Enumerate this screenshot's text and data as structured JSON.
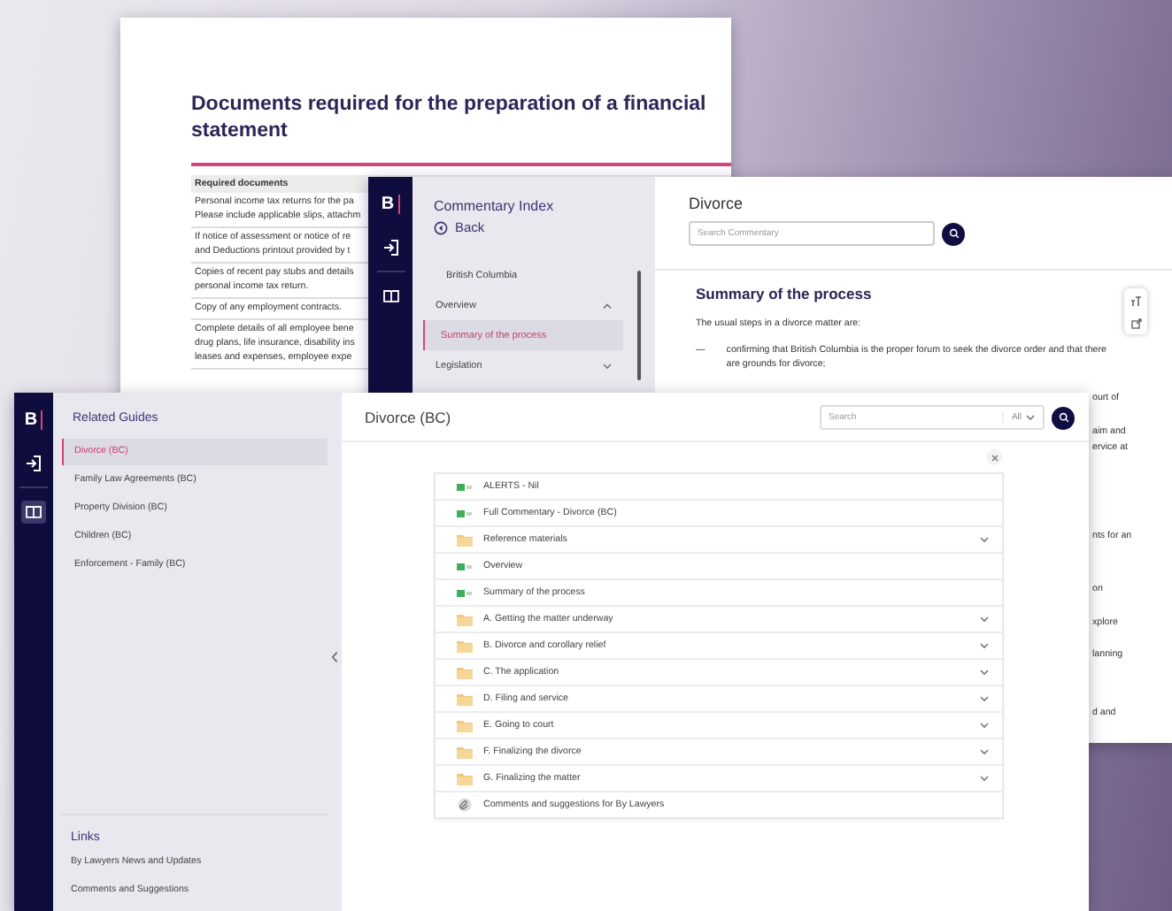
{
  "document_window": {
    "title": "Documents required for the preparation of a financial statement",
    "table_header": "Required documents",
    "rows": [
      [
        "Personal income tax returns for the pa",
        "Please include applicable slips, attachm"
      ],
      [
        "If notice of assessment or notice of re",
        "and Deductions printout provided by t"
      ],
      [
        "Copies of recent pay stubs and details",
        "personal income tax return."
      ],
      [
        "Copy of any employment contracts."
      ],
      [
        "Complete details of all employee bene",
        "drug plans, life insurance, disability ins",
        "leases and expenses, employee expe"
      ]
    ]
  },
  "commentary_window": {
    "logo": "B",
    "nav": [
      {
        "kind": "sign-in",
        "selected": false
      },
      {
        "kind": "book",
        "selected": false
      }
    ],
    "index_title": "Commentary Index",
    "back": "Back",
    "index_items": [
      {
        "label": "British Columbia",
        "kind": "page",
        "selected": false
      },
      {
        "label": "Overview",
        "kind": "section",
        "expanded": true,
        "selected": false
      },
      {
        "label": "Summary of the process",
        "kind": "page",
        "selected": true
      },
      {
        "label": "Legislation",
        "kind": "section",
        "expanded": false,
        "selected": false
      }
    ],
    "title": "Divorce",
    "search": {
      "placeholder": "Search Commentary"
    },
    "heading": "Summary of the process",
    "intro": "The usual steps in a divorce matter are:",
    "steps": [
      {
        "marker": "—",
        "text": "confirming that British Columbia is the proper forum to seek the divorce order and that there are grounds for divorce;"
      }
    ],
    "fragments": [
      "ourt of",
      "aim and",
      "ervice at",
      "nts for an",
      "on",
      "xplore",
      "lanning",
      "d and"
    ]
  },
  "guide_window": {
    "logo": "B",
    "nav": [
      {
        "kind": "sign-in",
        "selected": false
      },
      {
        "kind": "book",
        "selected": true
      }
    ],
    "panel_title": "Related Guides",
    "guides": [
      {
        "label": "Divorce (BC)",
        "selected": true
      },
      {
        "label": "Family Law Agreements (BC)",
        "selected": false
      },
      {
        "label": "Property Division (BC)",
        "selected": false
      },
      {
        "label": "Children (BC)",
        "selected": false
      },
      {
        "label": "Enforcement - Family (BC)",
        "selected": false
      }
    ],
    "links_title": "Links",
    "links": [
      "By Lawyers News and Updates",
      "Comments and Suggestions"
    ],
    "title": "Divorce (BC)",
    "search": {
      "placeholder": "Search",
      "scope": "All"
    },
    "contents": [
      {
        "kind": "document",
        "label": "ALERTS - Nil"
      },
      {
        "kind": "document",
        "label": "Full Commentary - Divorce (BC)"
      },
      {
        "kind": "folder",
        "label": "Reference materials"
      },
      {
        "kind": "document",
        "label": "Overview"
      },
      {
        "kind": "document",
        "label": "Summary of the process"
      },
      {
        "kind": "folder",
        "label": "A. Getting the matter underway"
      },
      {
        "kind": "folder",
        "label": "B. Divorce and corollary relief"
      },
      {
        "kind": "folder",
        "label": "C. The application"
      },
      {
        "kind": "folder",
        "label": "D. Filing and service"
      },
      {
        "kind": "folder",
        "label": "E. Going to court"
      },
      {
        "kind": "folder",
        "label": "F. Finalizing the divorce"
      },
      {
        "kind": "folder",
        "label": "G. Finalizing the matter"
      },
      {
        "kind": "link",
        "label": "Comments and suggestions for By Lawyers"
      }
    ]
  }
}
